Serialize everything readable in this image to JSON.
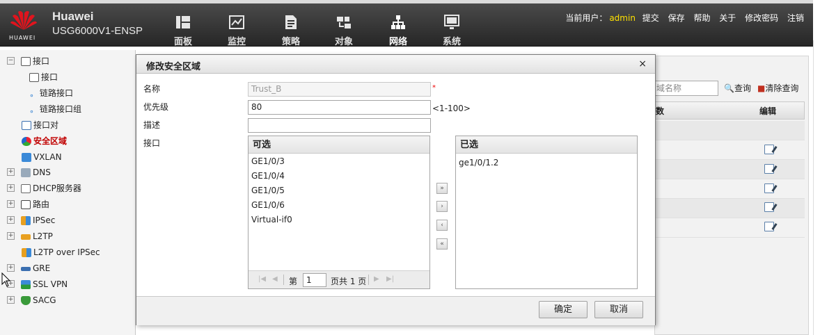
{
  "header": {
    "brand": "Huawei",
    "model": "USG6000V1-ENSP",
    "logo_text": "HUAWEI",
    "nav": [
      {
        "label": "面板",
        "icon": "dashboard-icon"
      },
      {
        "label": "监控",
        "icon": "monitor-icon"
      },
      {
        "label": "策略",
        "icon": "policy-icon"
      },
      {
        "label": "对象",
        "icon": "object-icon"
      },
      {
        "label": "网络",
        "icon": "network-icon"
      },
      {
        "label": "系统",
        "icon": "system-icon"
      }
    ],
    "current_user_label": "当前用户：",
    "current_user": "admin",
    "links": [
      "提交",
      "保存",
      "帮助",
      "关于",
      "修改密码",
      "注销"
    ]
  },
  "sidebar": {
    "items": [
      {
        "label": "接口",
        "icon": "interface-icon"
      },
      {
        "label": "接口",
        "icon": "interface-icon"
      },
      {
        "label": "链路接口",
        "icon": "link-interface-icon"
      },
      {
        "label": "链路接口组",
        "icon": "link-interface-group-icon"
      },
      {
        "label": "接口对",
        "icon": "interface-pair-icon"
      },
      {
        "label": "安全区域",
        "icon": "security-zone-icon"
      },
      {
        "label": "VXLAN",
        "icon": "vxlan-icon"
      },
      {
        "label": "DNS",
        "icon": "dns-icon"
      },
      {
        "label": "DHCP服务器",
        "icon": "dhcp-server-icon"
      },
      {
        "label": "路由",
        "icon": "route-icon"
      },
      {
        "label": "IPSec",
        "icon": "ipsec-icon"
      },
      {
        "label": "L2TP",
        "icon": "l2tp-icon"
      },
      {
        "label": "L2TP over IPSec",
        "icon": "l2tp-over-ipsec-icon"
      },
      {
        "label": "GRE",
        "icon": "gre-icon"
      },
      {
        "label": "SSL VPN",
        "icon": "ssl-vpn-icon"
      },
      {
        "label": "SACG",
        "icon": "sacg-icon"
      }
    ]
  },
  "background": {
    "search_placeholder": "域名称",
    "query_label": "查询",
    "clear_label": "清除查询",
    "col_partial": "数",
    "col_edit": "编辑"
  },
  "dialog": {
    "title": "修改安全区域",
    "close": "×",
    "name_label": "名称",
    "name_value": "Trust_B",
    "required_mark": "*",
    "priority_label": "优先级",
    "priority_value": "80",
    "priority_hint": "<1-100>",
    "desc_label": "描述",
    "desc_value": "",
    "iface_label": "接口",
    "available_head": "可选",
    "available": [
      "GE1/0/3",
      "GE1/0/4",
      "GE1/0/5",
      "GE1/0/6",
      "Virtual-if0"
    ],
    "selected_head": "已选",
    "selected": [
      "ge1/0/1.2"
    ],
    "pager": {
      "page_prefix": "第",
      "page_value": "1",
      "page_suffix": "页共 1 页"
    },
    "move_buttons": [
      "»",
      "›",
      "‹",
      "«"
    ],
    "ok": "确定",
    "cancel": "取消"
  }
}
